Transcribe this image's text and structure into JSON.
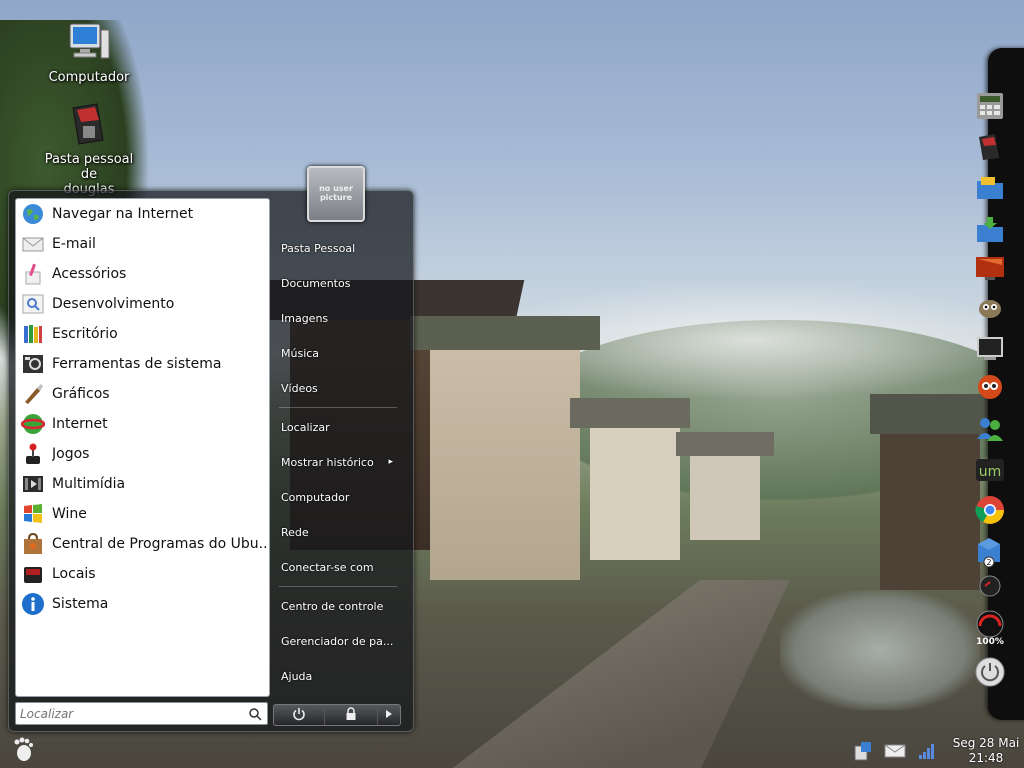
{
  "desktop": {
    "icons": [
      {
        "label": "Computador",
        "icon": "computer-icon"
      },
      {
        "label": "Pasta pessoal de",
        "label2": "douglas",
        "icon": "home-folder-icon"
      }
    ]
  },
  "start_menu": {
    "avatar_text": "no user picture",
    "apps": [
      {
        "label": "Navegar na Internet",
        "icon": "globe-icon"
      },
      {
        "label": "E-mail",
        "icon": "mail-icon"
      },
      {
        "label": "Acessórios",
        "icon": "accessories-icon"
      },
      {
        "label": "Desenvolvimento",
        "icon": "development-icon"
      },
      {
        "label": "Escritório",
        "icon": "office-icon"
      },
      {
        "label": "Ferramentas de sistema",
        "icon": "system-tools-icon"
      },
      {
        "label": "Gráficos",
        "icon": "graphics-icon"
      },
      {
        "label": "Internet",
        "icon": "internet-icon"
      },
      {
        "label": "Jogos",
        "icon": "games-icon"
      },
      {
        "label": "Multimídia",
        "icon": "multimedia-icon"
      },
      {
        "label": "Wine",
        "icon": "wine-icon"
      },
      {
        "label": "Central de Programas do Ubu...",
        "icon": "software-center-icon"
      },
      {
        "label": "Locais",
        "icon": "places-icon"
      },
      {
        "label": "Sistema",
        "icon": "info-icon"
      }
    ],
    "search_placeholder": "Localizar",
    "places": [
      {
        "label": "Pasta Pessoal"
      },
      {
        "label": "Documentos"
      },
      {
        "label": "Imagens"
      },
      {
        "label": "Música"
      },
      {
        "label": "Vídeos"
      },
      {
        "label": "Localizar"
      },
      {
        "label": "Mostrar histórico",
        "submenu": "▸"
      },
      {
        "label": "Computador"
      },
      {
        "label": "Rede"
      },
      {
        "label": "Conectar-se com"
      },
      {
        "label": "Centro de controle"
      },
      {
        "label": "Gerenciador de pa..."
      },
      {
        "label": "Ajuda"
      }
    ]
  },
  "dock": {
    "badge_count": "2",
    "gauge_label": "100%"
  },
  "tray": {
    "clock_line1": "Seg 28 Mai",
    "clock_line2": "21:48"
  },
  "colors": {
    "menu_bg": "#16181c",
    "accent": "#1e6fcc"
  }
}
